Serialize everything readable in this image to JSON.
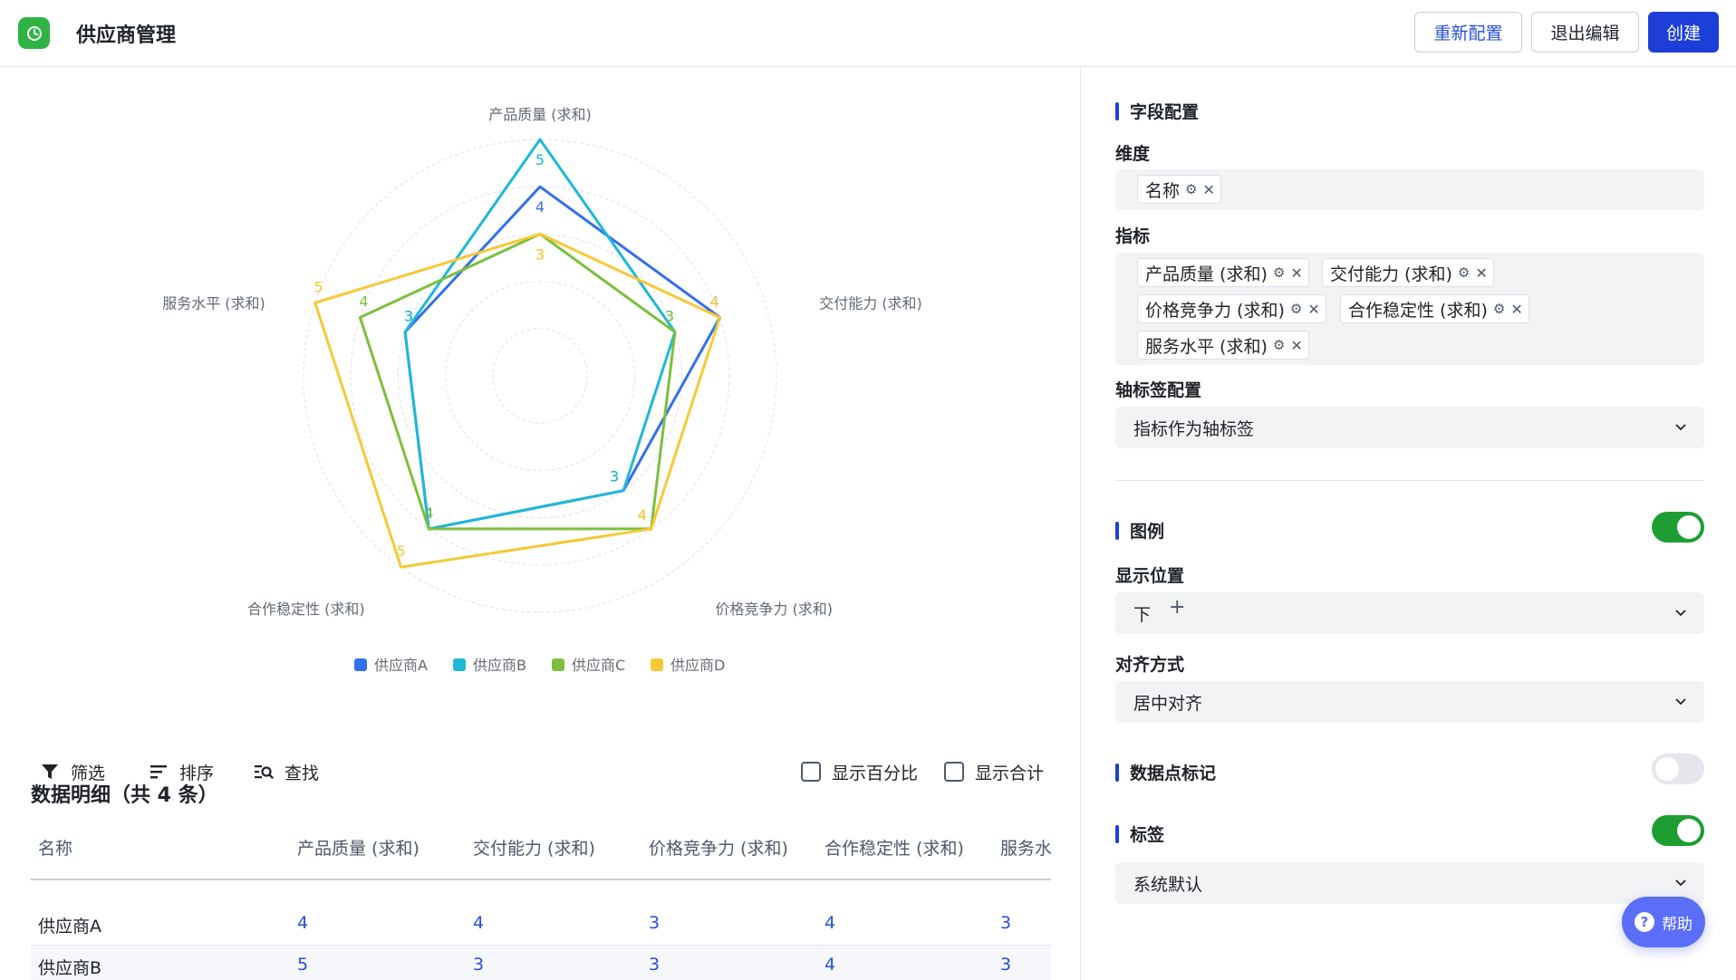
{
  "header": {
    "title": "供应商管理",
    "reconfig_label": "重新配置",
    "exit_label": "退出编辑",
    "create_label": "创建"
  },
  "chart_data": {
    "type": "radar",
    "indicators": [
      "产品质量 (求和)",
      "交付能力 (求和)",
      "价格竞争力 (求和)",
      "合作稳定性 (求和)",
      "服务水平 (求和)"
    ],
    "max": 5,
    "series": [
      {
        "name": "供应商A",
        "color": "#3370eb",
        "values": [
          4,
          4,
          3,
          4,
          3
        ]
      },
      {
        "name": "供应商B",
        "color": "#1fb8d6",
        "values": [
          5,
          3,
          3,
          4,
          3
        ]
      },
      {
        "name": "供应商C",
        "color": "#7cbf3d",
        "values": [
          3,
          3,
          4,
          4,
          4
        ]
      },
      {
        "name": "供应商D",
        "color": "#f7c836",
        "values": [
          3,
          4,
          4,
          5,
          5
        ]
      }
    ],
    "legend_position": "bottom"
  },
  "details": {
    "title": "数据明细（共 4 条）",
    "filter_label": "筛选",
    "sort_label": "排序",
    "find_label": "查找",
    "show_percent_label": "显示百分比",
    "show_total_label": "显示合计",
    "columns": [
      "名称",
      "产品质量 (求和)",
      "交付能力 (求和)",
      "价格竞争力 (求和)",
      "合作稳定性 (求和)",
      "服务水"
    ],
    "rows": [
      {
        "name": "供应商A",
        "values": [
          "4",
          "4",
          "3",
          "4",
          "3"
        ]
      },
      {
        "name": "供应商B",
        "values": [
          "5",
          "3",
          "3",
          "4",
          "3"
        ]
      }
    ]
  },
  "config": {
    "field_section": "字段配置",
    "dimension_label": "维度",
    "dimension_chips": [
      "名称"
    ],
    "metric_label": "指标",
    "metric_chips": [
      "产品质量 (求和)",
      "交付能力 (求和)",
      "价格竞争力 (求和)",
      "合作稳定性 (求和)",
      "服务水平 (求和)"
    ],
    "axis_label_config": "轴标签配置",
    "axis_label_value": "指标作为轴标签",
    "legend_section": "图例",
    "legend_enabled": true,
    "position_label": "显示位置",
    "position_value": "下",
    "align_label": "对齐方式",
    "align_value": "居中对齐",
    "datapoint_section": "数据点标记",
    "datapoint_enabled": false,
    "label_section": "标签",
    "label_enabled": true,
    "label_value": "系统默认"
  },
  "help": {
    "label": "帮助"
  },
  "colors": {
    "accent": "#1d3fd8",
    "toggle_on": "#1e9e32",
    "brand_green": "#2fb344"
  }
}
